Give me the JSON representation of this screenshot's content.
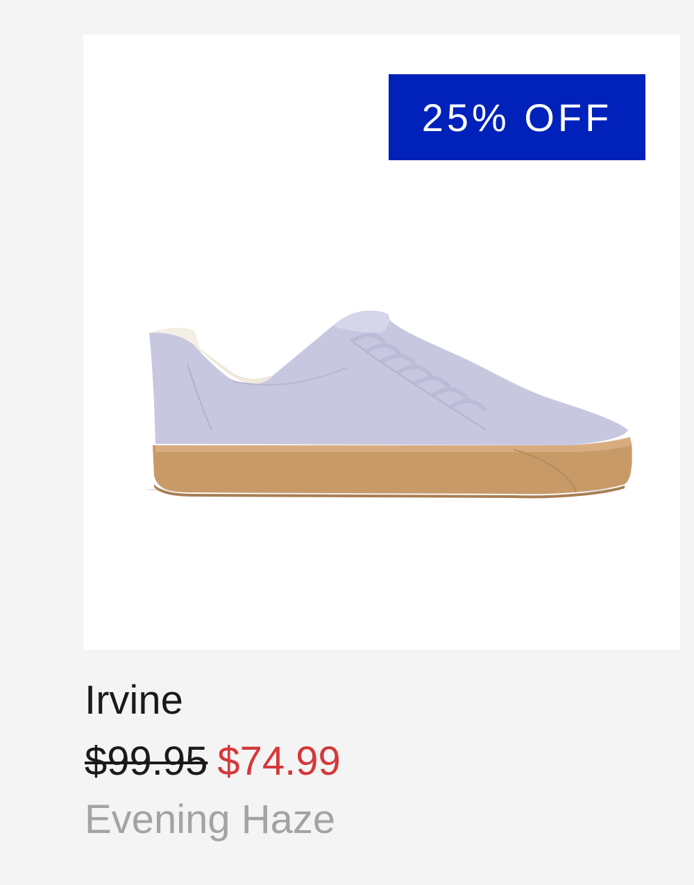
{
  "product": {
    "badge": "25% OFF",
    "name": "Irvine",
    "price_original": "$99.95",
    "price_sale": "$74.99",
    "color": "Evening Haze",
    "image_description": "Lavender canvas low-top sneaker with gum sole"
  },
  "colors": {
    "page_background": "#f4f4f4",
    "image_background": "#ffffff",
    "badge_background": "#0022bb",
    "badge_text": "#ffffff",
    "sale_price": "#d5383a",
    "color_name": "#a3a3a3",
    "shoe_upper": "#c8c7e0",
    "shoe_sole": "#c89a68"
  },
  "icons": {
    "product_image": "sneaker-image"
  }
}
